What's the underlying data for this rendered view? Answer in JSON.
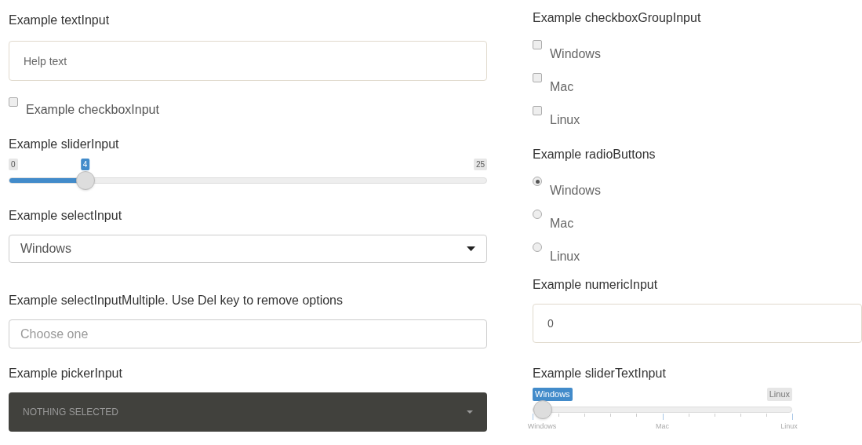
{
  "text_input": {
    "label": "Example textInput",
    "placeholder": "Help text"
  },
  "checkbox": {
    "label": "Example checkboxInput",
    "checked": false
  },
  "slider": {
    "label": "Example sliderInput",
    "min": "0",
    "max": "25",
    "value_label": "4",
    "level": 0.16
  },
  "select": {
    "label": "Example selectInput",
    "value": "Windows"
  },
  "select_multiple": {
    "label": "Example selectInputMultiple. Use Del key to remove options",
    "placeholder": "Choose one"
  },
  "picker": {
    "label": "Example pickerInput",
    "placeholder": "NOTHING SELECTED"
  },
  "checkbox_group": {
    "label": "Example checkboxGroupInput",
    "options": [
      {
        "label": "Windows",
        "checked": false
      },
      {
        "label": "Mac",
        "checked": false
      },
      {
        "label": "Linux",
        "checked": false
      }
    ]
  },
  "radio": {
    "label": "Example radioButtons",
    "options": [
      {
        "label": "Windows",
        "selected": true
      },
      {
        "label": "Mac",
        "selected": false
      },
      {
        "label": "Linux",
        "selected": false
      }
    ]
  },
  "numeric": {
    "label": "Example numericInput",
    "value": "0"
  },
  "slider_text": {
    "label": "Example sliderTextInput",
    "value_label": "Windows",
    "max_label": "Linux",
    "level": 0,
    "ticks": [
      "Windows",
      "Mac",
      "Linux"
    ]
  }
}
